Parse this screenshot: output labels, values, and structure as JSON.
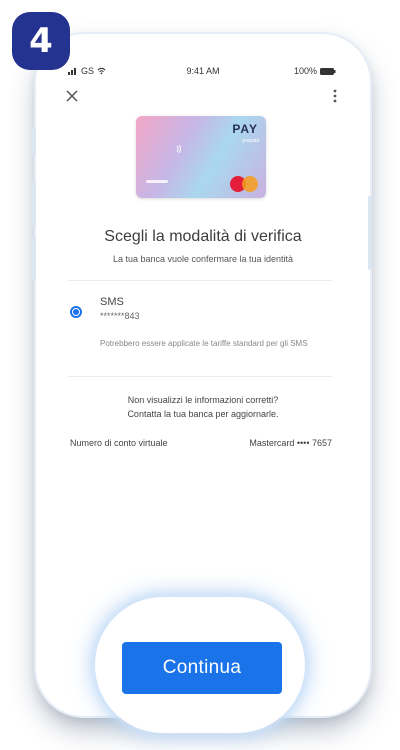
{
  "step_badge": "4",
  "status_bar": {
    "carrier": "GS",
    "time": "9:41 AM",
    "battery": "100%"
  },
  "toolbar": {
    "close_icon": "close-icon",
    "menu_icon": "more-vert-icon"
  },
  "card": {
    "brand": "PAY",
    "subtitle": "prepaid",
    "network": "mastercard"
  },
  "title": "Scegli la modalità di verifica",
  "subtitle": "La tua banca vuole confermare la tua identità",
  "option": {
    "selected": true,
    "label": "SMS",
    "masked_number": "*******843",
    "note": "Potrebbero essere applicate le tariffe standard per gli SMS"
  },
  "info": {
    "line1": "Non visualizzi le informazioni corretti?",
    "line2": "Contatta la tua banca per aggiornarle."
  },
  "account": {
    "label": "Numero di conto virtuale",
    "value": "Mastercard •••• 7657"
  },
  "continue_label": "Continua",
  "colors": {
    "accent": "#1a73e8",
    "badge": "#24338f"
  }
}
